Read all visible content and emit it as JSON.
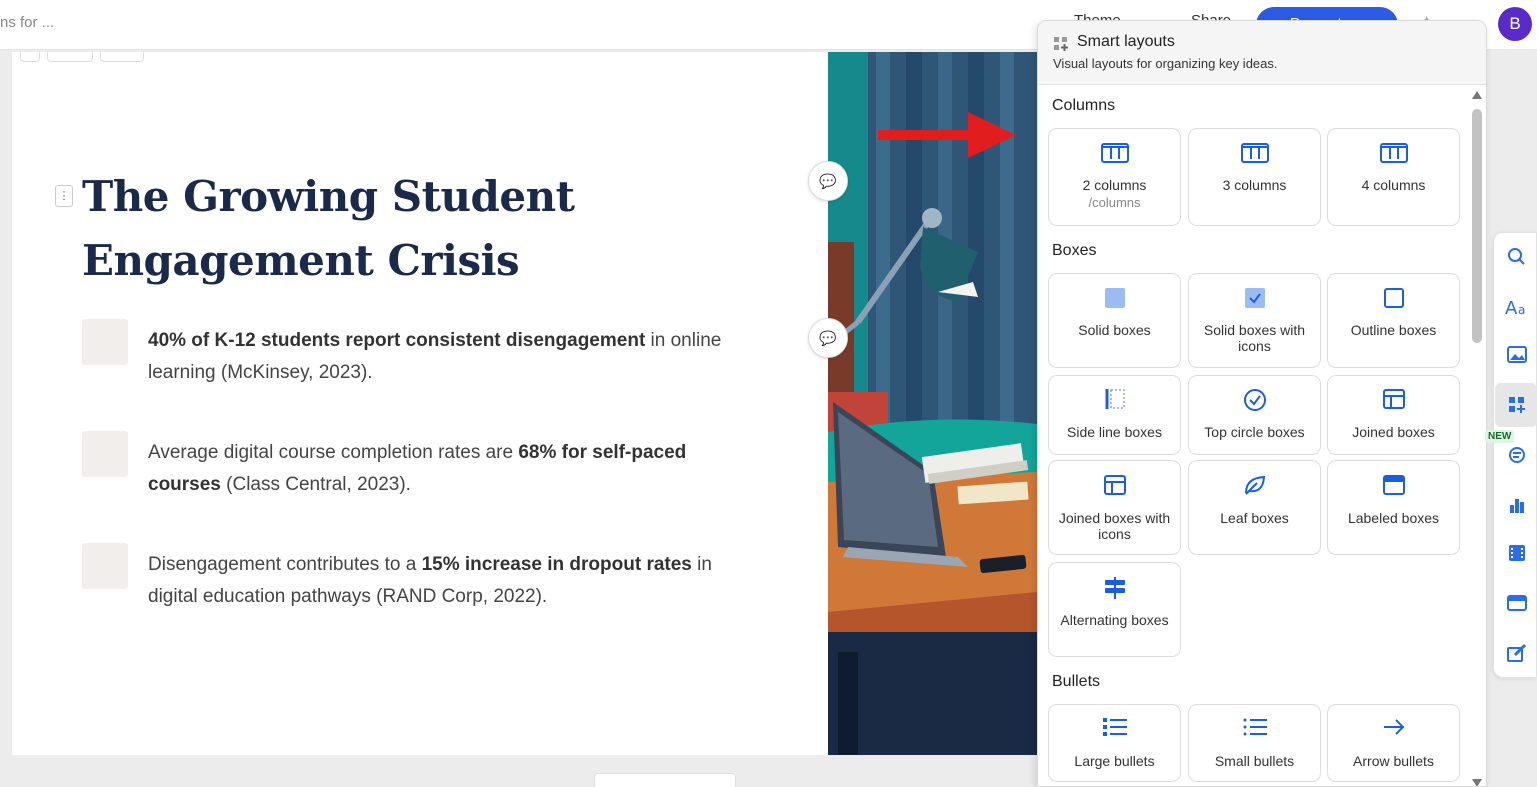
{
  "topbar": {
    "search_placeholder": "ns for ...",
    "theme_label": "Theme",
    "share_label": "Share",
    "present_label": "Present",
    "avatar_initial": "B"
  },
  "slide": {
    "title": "The Growing Student Engagement Crisis",
    "bullets": [
      {
        "bold": "40% of K-12 students report consistent disengagement",
        "rest": " in online learning (McKinsey, 2023)."
      },
      {
        "pre": "Average digital course completion rates are ",
        "bold": "68% for self-paced courses",
        "rest": " (Class Central, 2023)."
      },
      {
        "pre": "Disengagement contributes to a ",
        "bold": "15% increase in dropout rates",
        "rest": " in digital education pathways (RAND Corp, 2022)."
      }
    ]
  },
  "panel": {
    "title": "Smart layouts",
    "subtitle": "Visual layouts for organizing key ideas.",
    "sections": {
      "columns": "Columns",
      "boxes": "Boxes",
      "bullets": "Bullets"
    },
    "columns": {
      "two": "2 columns",
      "two_sub": "/columns",
      "three": "3 columns",
      "four": "4 columns"
    },
    "boxes": {
      "solid": "Solid boxes",
      "solid_icons": "Solid boxes with icons",
      "outline": "Outline boxes",
      "side_line": "Side line boxes",
      "top_circle": "Top circle boxes",
      "joined": "Joined boxes",
      "joined_icons": "Joined boxes with icons",
      "leaf": "Leaf boxes",
      "labeled": "Labeled boxes",
      "alternating": "Alternating boxes"
    },
    "bullets": {
      "large": "Large bullets",
      "small": "Small bullets",
      "arrow": "Arrow bullets"
    }
  },
  "rail": {
    "new_badge": "NEW"
  },
  "colors": {
    "accent": "#1a5fe0",
    "present": "#2d5be3",
    "avatar": "#5b2bc9",
    "title": "#1b2a4b"
  }
}
